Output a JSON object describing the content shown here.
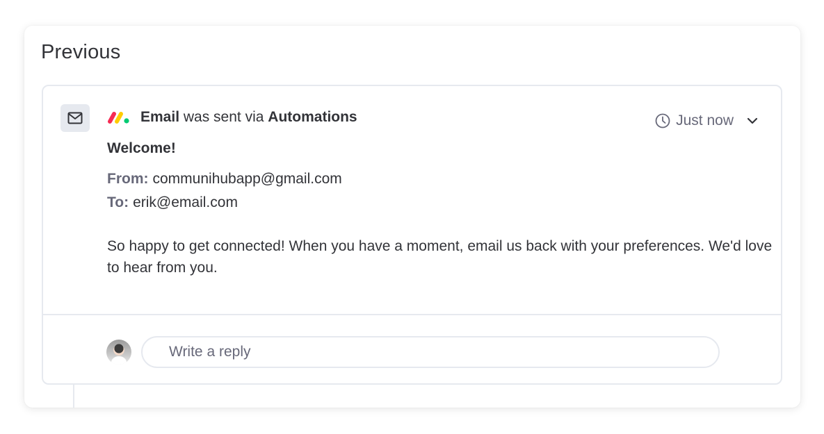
{
  "section": {
    "title": "Previous"
  },
  "email": {
    "source_label": "Email",
    "connector_text": "was sent via",
    "via_label": "Automations",
    "time_label": "Just now",
    "subject": "Welcome!",
    "from_label": "From:",
    "from_value": "communihubapp@gmail.com",
    "to_label": "To:",
    "to_value": "erik@email.com",
    "body": "So happy to get connected! When you have a moment, email us back with your preferences. We'd love to hear from you."
  },
  "reply": {
    "placeholder": "Write a reply"
  },
  "icons": {
    "mail": "envelope-icon",
    "logo": "monday-logo",
    "clock": "clock-icon",
    "expand": "chevron-down-icon"
  },
  "colors": {
    "logo_red": "#f62b54",
    "logo_yellow": "#ffcc00",
    "logo_green": "#00ca72",
    "muted_text": "#676879",
    "border": "#e6e9ef"
  }
}
